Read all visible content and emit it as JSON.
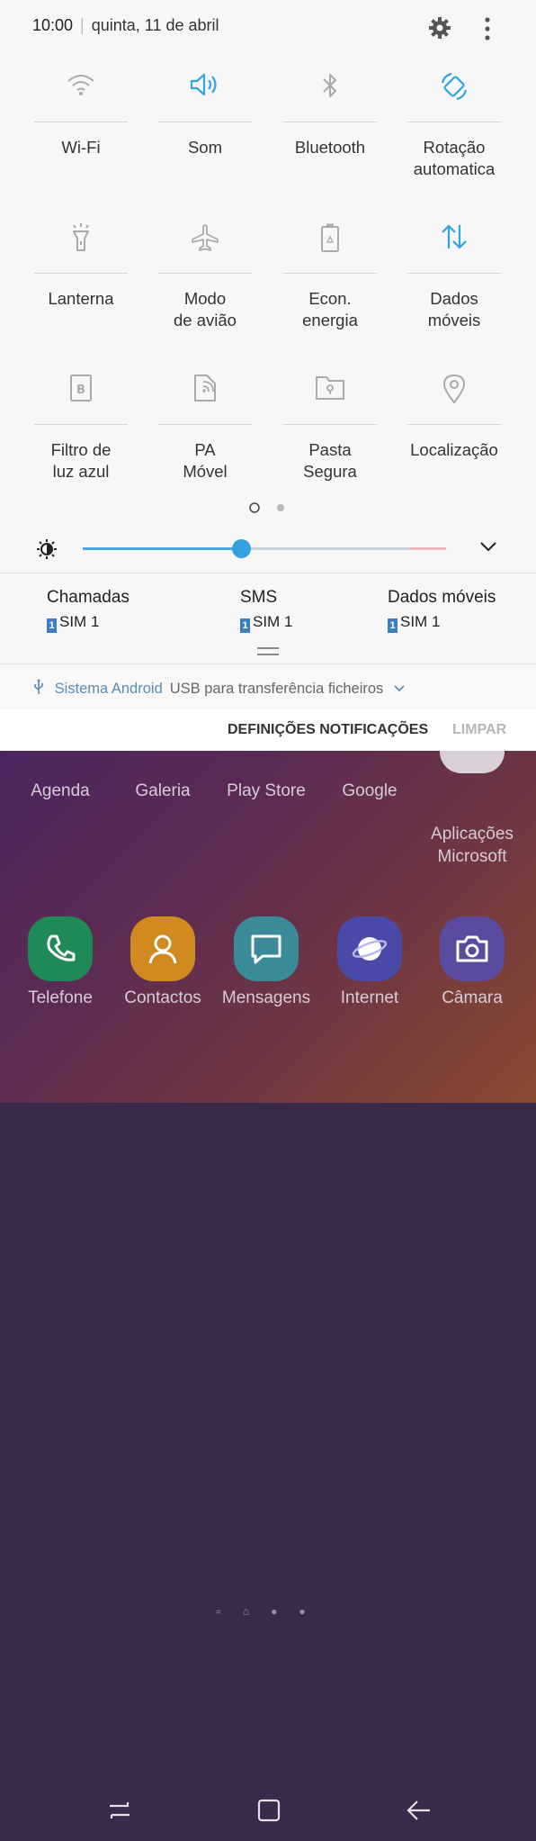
{
  "status": {
    "time": "10:00",
    "separator": "|",
    "date": "quinta, 11 de abril"
  },
  "quick_settings": {
    "tiles": [
      {
        "label": "Wi-Fi",
        "icon": "wifi-icon",
        "active": false
      },
      {
        "label": "Som",
        "icon": "sound-icon",
        "active": true
      },
      {
        "label": "Bluetooth",
        "icon": "bluetooth-icon",
        "active": false
      },
      {
        "label": "Rotação\nautomatica",
        "icon": "rotation-icon",
        "active": true
      },
      {
        "label": "Lanterna",
        "icon": "flashlight-icon",
        "active": false
      },
      {
        "label": "Modo\nde avião",
        "icon": "airplane-icon",
        "active": false
      },
      {
        "label": "Econ.\nenergia",
        "icon": "battery-saver-icon",
        "active": false
      },
      {
        "label": "Dados\nmóveis",
        "icon": "mobile-data-icon",
        "active": true
      },
      {
        "label": "Filtro de\nluz azul",
        "icon": "blue-light-icon",
        "active": false
      },
      {
        "label": "PA\nMóvel",
        "icon": "hotspot-icon",
        "active": false
      },
      {
        "label": "Pasta\nSegura",
        "icon": "secure-folder-icon",
        "active": false
      },
      {
        "label": "Localização",
        "icon": "location-icon",
        "active": false
      }
    ],
    "page_indicator": {
      "pages": 2,
      "current": 1
    },
    "brightness_level": 0.48
  },
  "sim": {
    "columns": [
      {
        "title": "Chamadas",
        "sim_number": "1",
        "sim_label": "SIM 1"
      },
      {
        "title": "SMS",
        "sim_number": "1",
        "sim_label": "SIM 1"
      },
      {
        "title": "Dados móveis",
        "sim_number": "1",
        "sim_label": "SIM 1"
      }
    ]
  },
  "notification": {
    "app": "Sistema Android",
    "text": "USB para transferência ficheiros"
  },
  "actions": {
    "settings": "DEFINIÇÕES NOTIFICAÇÕES",
    "clear": "LIMPAR"
  },
  "home_apps_row1": [
    "Agenda",
    "Galeria",
    "Play Store",
    "Google",
    "Aplicações\nMicrosoft"
  ],
  "dock_apps": [
    "Telefone",
    "Contactos",
    "Mensagens",
    "Internet",
    "Câmara"
  ],
  "colors": {
    "accent": "#33a1de",
    "inactive_icon": "#9e9e9e",
    "panel_bg": "#f7f7f7"
  }
}
